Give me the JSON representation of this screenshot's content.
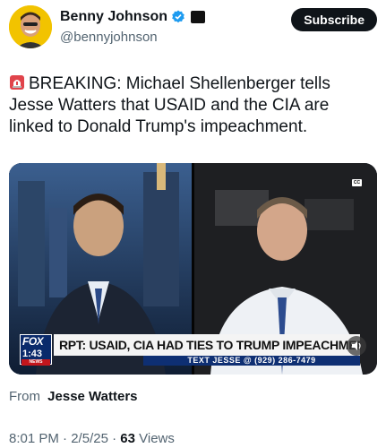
{
  "author": {
    "display_name": "Benny Johnson",
    "handle": "@bennyjohnson",
    "affiliation_badge_text": "News Outlet"
  },
  "subscribe_label": "Subscribe",
  "tweet": {
    "text": "BREAKING: Michael Shellenberger tells Jesse Watters that USAID and the CIA are linked to Donald Trump's impeachment.",
    "emoji_icon": "siren-icon"
  },
  "video": {
    "chyron_headline": "RPT: USAID, CIA HAD TIES TO TRUMP IMPEACHMENT",
    "chyron_subline": "TEXT JESSE @ (929) 286-7479",
    "network_logo": "FOX",
    "timestamp": "1:43",
    "cc_label": "CC",
    "live_label": "NEWS"
  },
  "source": {
    "from_label": "From",
    "from_name": "Jesse Watters"
  },
  "meta": {
    "time": "8:01 PM",
    "separator": "·",
    "date": "2/5/25",
    "views_count": "63",
    "views_label": "Views"
  },
  "colors": {
    "verified": "#1d9bf0",
    "text_primary": "#0f1419",
    "text_secondary": "#536471",
    "fox_blue": "#0e2f73"
  }
}
